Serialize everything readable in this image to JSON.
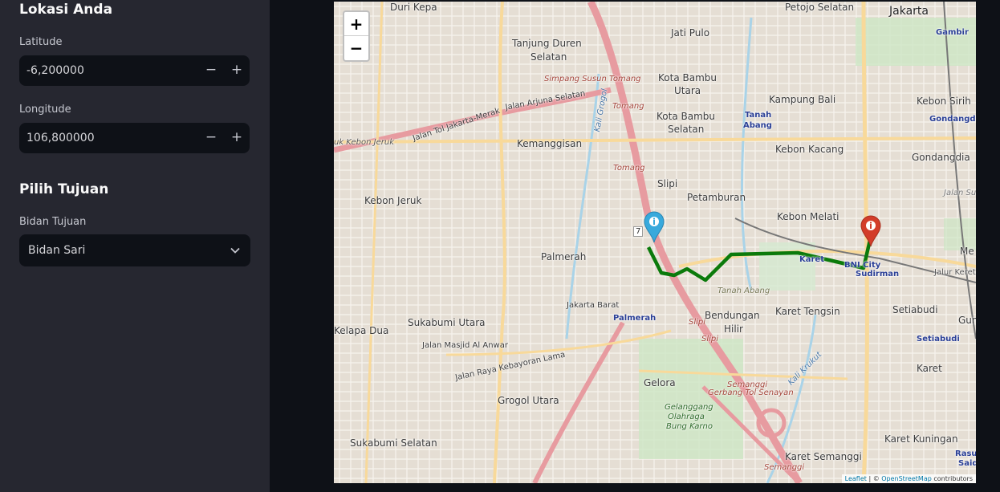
{
  "sidebar": {
    "location_title": "Lokasi Anda",
    "latitude": {
      "label": "Latitude",
      "value": "-6,200000",
      "minus": "−",
      "plus": "+"
    },
    "longitude": {
      "label": "Longitude",
      "value": "106,800000",
      "minus": "−",
      "plus": "+"
    },
    "destination_title": "Pilih Tujuan",
    "destination": {
      "label": "Bidan Tujuan",
      "value": "Bidan Sari"
    }
  },
  "map": {
    "zoom_in": "+",
    "zoom_out": "−",
    "route_color": "#0b7a0b",
    "origin_marker_color": "#38a9dc",
    "destination_marker_color": "#d33d2a",
    "attribution": {
      "leaflet": "Leaflet",
      "sep": " | © ",
      "osm": "OpenStreetMap",
      "suffix": " contributors"
    },
    "labels": {
      "duri_kepa": "Duri Kepa",
      "petojo_selatan": "Petojo Selatan",
      "jakarta": "Jakarta",
      "gambir": "Gambir",
      "jati_pulo": "Jati Pulo",
      "tanjung_duren": "Tanjung Duren",
      "selatan1": "Selatan",
      "simpang_susun_tomang": "Simpang Susun Tomang",
      "kota_bambu_utara": "Kota Bambu",
      "utara": "Utara",
      "kampung_bali": "Kampung Bali",
      "kebon_sirih": "Kebon Sirih",
      "gondangdia_small": "Gondangdia",
      "jalan_arjuna_selatan": "Jalan Arjuna Selatan",
      "tomang1": "Tomang",
      "kota_bambu_selatan": "Kota Bambu",
      "selatan2": "Selatan",
      "tanah_abang": "Tanah",
      "abang": "Abang",
      "jalan_tol": "Jalan Tol Jakarta-Merak",
      "kebon_jeruk_road": "uk Kebon Jeruk",
      "kemanggisan": "Kemanggisan",
      "kebon_kacang": "Kebon Kacang",
      "gondangdia": "Gondangdia",
      "tomang2": "Tomang",
      "slipi": "Slipi",
      "petamburan": "Petamburan",
      "kebon_jeruk": "Kebon Jeruk",
      "kebon_melati": "Kebon Melati",
      "jalan_sudirman": "Jalan Sud",
      "palmerah": "Palmerah",
      "karet": "Karet",
      "bni_city": "BNI City",
      "sudirman": "Sudirman",
      "jalur_kereta": "Jalur Kereta A",
      "tanah_abang2": "Tanah Abang",
      "jakarta_barat": "Jakarta Barat",
      "bendungan": "Bendungan",
      "hilir": "Hilir",
      "karet_tengsin": "Karet Tengsin",
      "setiabudi": "Setiabudi",
      "palmerah_station": "Palmerah",
      "sukabumi_utara": "Sukabumi Utara",
      "kelapa_dua": "Kelapa Dua",
      "jalan_masjid": "Jalan Masjid Al Anwar",
      "slipi2": "Slipi",
      "slipi3": "Slipi",
      "setiabudi_st": "Setiabudi",
      "jalan_raya_kebayoran": "Jalan Raya Kebayoran Lama",
      "karet2": "Karet",
      "gelora": "Gelora",
      "semanggi": "Semanggi",
      "gerbang_tol": "Gerbang Tol Senayan",
      "grogol_utara": "Grogol Utara",
      "gelanggang": "Gelanggang",
      "olahraga": "Olahraga",
      "bung_karno": "Bung Karno",
      "sukabumi_selatan": "Sukabumi Selatan",
      "karet_kuningan": "Karet Kuningan",
      "karet_semanggi": "Karet Semanggi",
      "rasuna": "Rasuna",
      "said": "Said",
      "semanggi2": "Semanggi",
      "menteng_m": "Me",
      "guntur": "Guntu",
      "kali_grogol": "Kali Grogol",
      "kali_krukut": "Kali Krukut",
      "route_7": "7"
    }
  }
}
